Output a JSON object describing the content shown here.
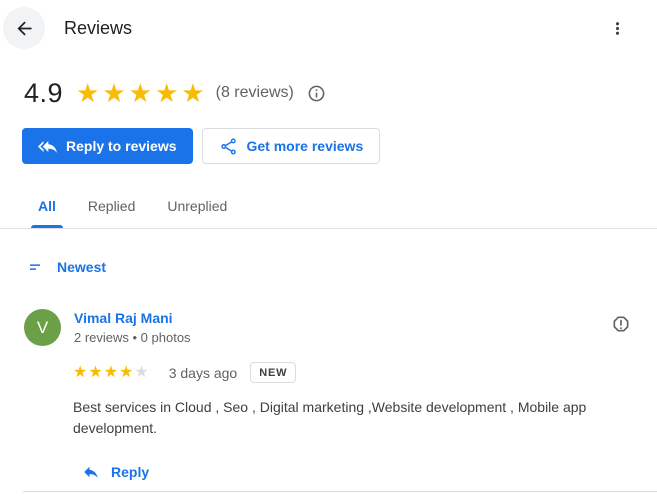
{
  "header": {
    "title": "Reviews",
    "back_icon": "arrow-left",
    "menu_icon": "kebab-menu"
  },
  "summary": {
    "rating": "4.9",
    "stars_filled": 5,
    "stars_total": 5,
    "reviews_count_label": "(8 reviews)",
    "info_icon": "info-circle"
  },
  "actions": {
    "reply_button_label": "Reply to reviews",
    "reply_button_icon": "reply-all-arrow",
    "get_more_button_label": "Get more reviews",
    "get_more_button_icon": "share-nodes"
  },
  "tabs": [
    {
      "label": "All",
      "active": true
    },
    {
      "label": "Replied",
      "active": false
    },
    {
      "label": "Unreplied",
      "active": false
    }
  ],
  "sort": {
    "label": "Newest",
    "icon": "sort-lines"
  },
  "review": {
    "author": "Vimal Raj Mani",
    "author_initial": "V",
    "meta": "2 reviews • 0 photos",
    "stars_filled": 4,
    "stars_total": 5,
    "date": "3 days ago",
    "badge": "NEW",
    "report_icon": "report-octagon",
    "text": "Best services in Cloud , Seo , Digital marketing ,Website development , Mobile app development.",
    "reply_label": "Reply",
    "reply_icon": "reply-arrow"
  },
  "colors": {
    "accent_blue": "#1a73e8",
    "star_gold": "#fabb05",
    "star_empty": "#dadce0",
    "avatar_green": "#6ba046",
    "text_primary": "#202124",
    "text_secondary": "#5f6368",
    "border_gray": "#dadce0"
  }
}
